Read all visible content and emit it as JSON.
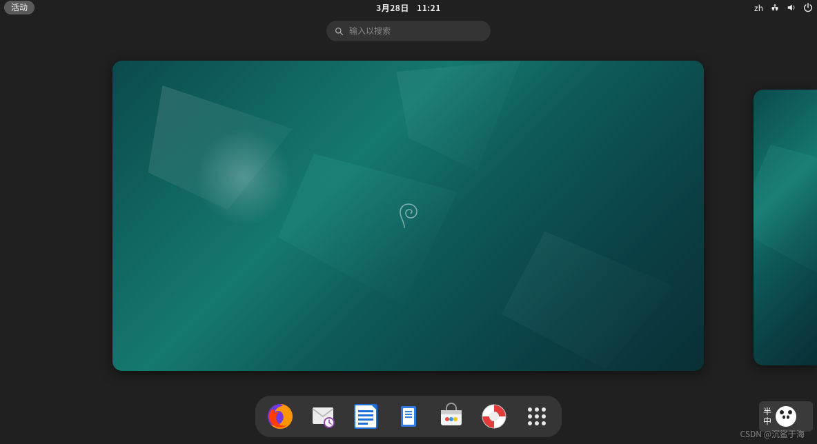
{
  "top_panel": {
    "activities_label": "活动",
    "date": "3月28日",
    "time": "11:21",
    "input_method": "zh"
  },
  "search": {
    "placeholder": "输入以搜索"
  },
  "workspaces": {
    "swirl_label": "Debian"
  },
  "dock": {
    "items": [
      {
        "name": "firefox"
      },
      {
        "name": "evolution-mail"
      },
      {
        "name": "libreoffice-writer"
      },
      {
        "name": "files"
      },
      {
        "name": "software-store"
      },
      {
        "name": "help"
      },
      {
        "name": "show-applications"
      }
    ]
  },
  "badge": {
    "line1": "半",
    "line2": "中"
  },
  "watermark": "CSDN @沉鲨于海"
}
